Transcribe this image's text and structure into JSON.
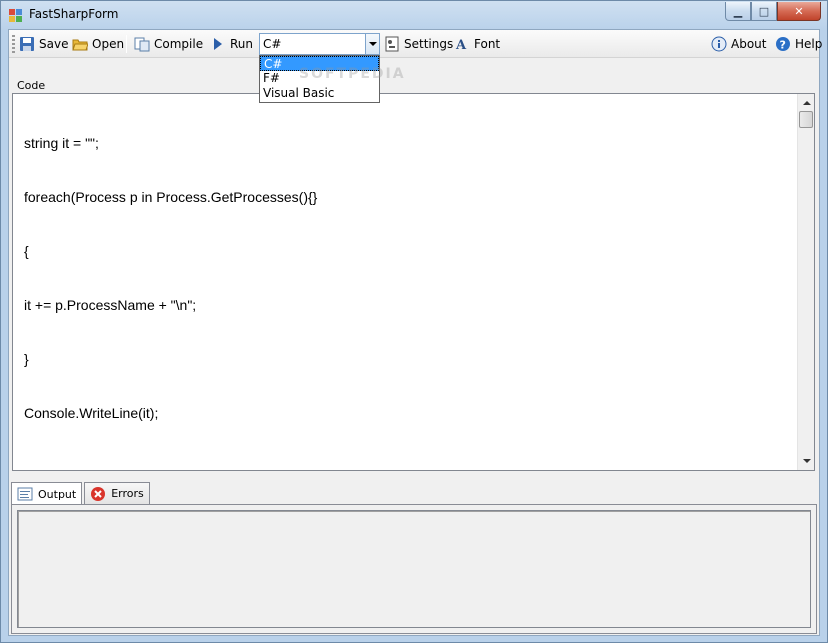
{
  "window": {
    "title": "FastSharpForm"
  },
  "titlebar": {
    "minimize_glyph": "▁",
    "maximize_glyph": "□",
    "close_glyph": "✕"
  },
  "toolbar": {
    "save": "Save",
    "open": "Open",
    "compile": "Compile",
    "run": "Run",
    "settings": "Settings",
    "font": "Font",
    "about": "About",
    "help": "Help"
  },
  "language_select": {
    "selected": "C#",
    "options": [
      "C#",
      "F#",
      "Visual Basic"
    ]
  },
  "code_group": {
    "label": "Code",
    "lines": [
      "string it = \"\";",
      "foreach(Process p in Process.GetProcesses(){}",
      "{",
      "it += p.ProcessName + \"\\n\";",
      "}",
      "Console.WriteLine(it);"
    ]
  },
  "bottom_tabs": {
    "output": "Output",
    "errors": "Errors"
  },
  "watermark": "SOFTPEDIA",
  "colors": {
    "accent": "#3399ff",
    "frame": "#b9d1ea",
    "close": "#c0432b"
  }
}
